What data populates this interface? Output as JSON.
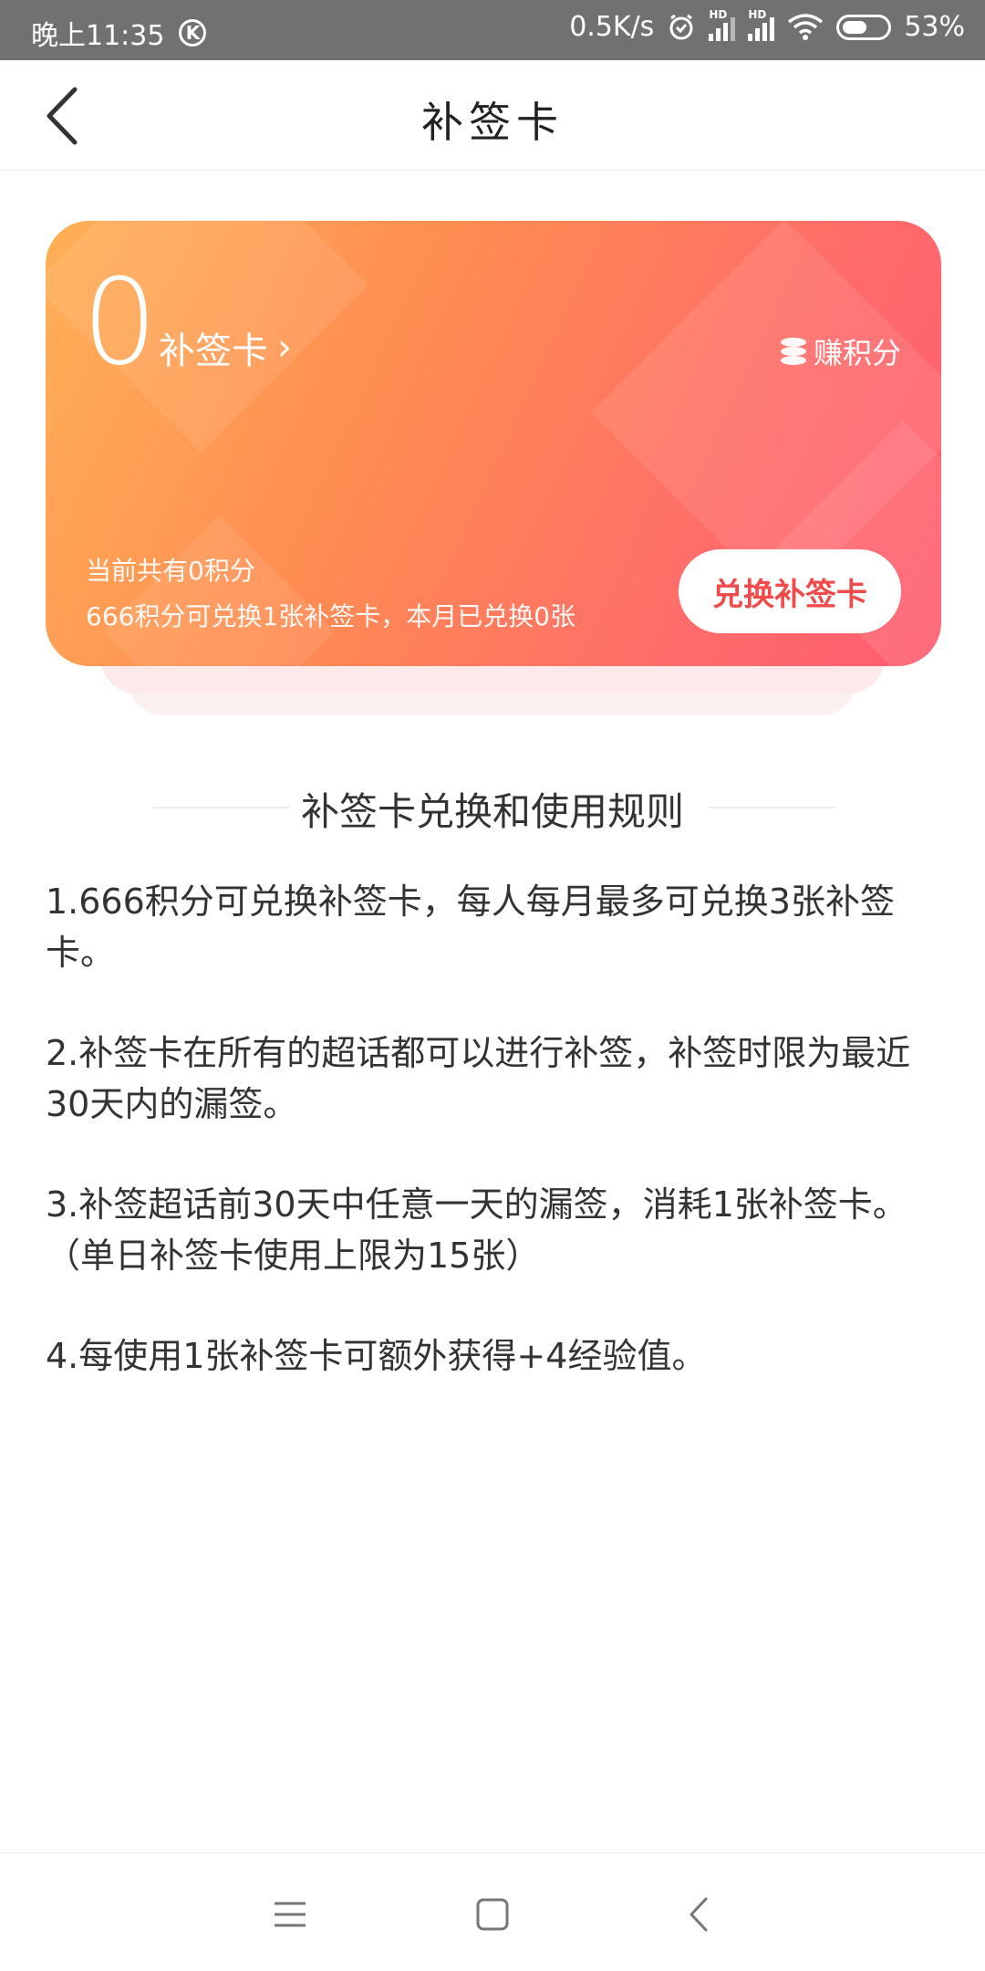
{
  "status_bar": {
    "time": "晚上11:35",
    "network_speed": "0.5K/s",
    "battery_percent": "53%",
    "signal_tag": "HD"
  },
  "header": {
    "title": "补签卡"
  },
  "card": {
    "count": "0",
    "card_link": "补签卡",
    "link_chevron": "›",
    "earn_label": "赚积分",
    "points_info": "当前共有0积分",
    "exchange_info": "666积分可兑换1张补签卡，本月已兑换0张",
    "exchange_button": "兑换补签卡",
    "accent_color": "#f04b4b"
  },
  "rules": {
    "title": "补签卡兑换和使用规则",
    "items": [
      "1.666积分可兑换补签卡，每人每月最多可兑换3张补签卡。",
      "2.补签卡在所有的超话都可以进行补签，补签时限为最近30天内的漏签。",
      "3.补签超话前30天中任意一天的漏签，消耗1张补签卡。（单日补签卡使用上限为15张）",
      "4.每使用1张补签卡可额外获得+4经验值。"
    ]
  },
  "icons": {
    "back": "back-arrow-icon",
    "earn": "coin-stack-icon",
    "alarm": "alarm-icon",
    "wifi": "wifi-icon",
    "battery": "battery-icon",
    "nav_menu": "menu-icon",
    "nav_home": "home-square-icon",
    "nav_back": "nav-back-icon"
  }
}
